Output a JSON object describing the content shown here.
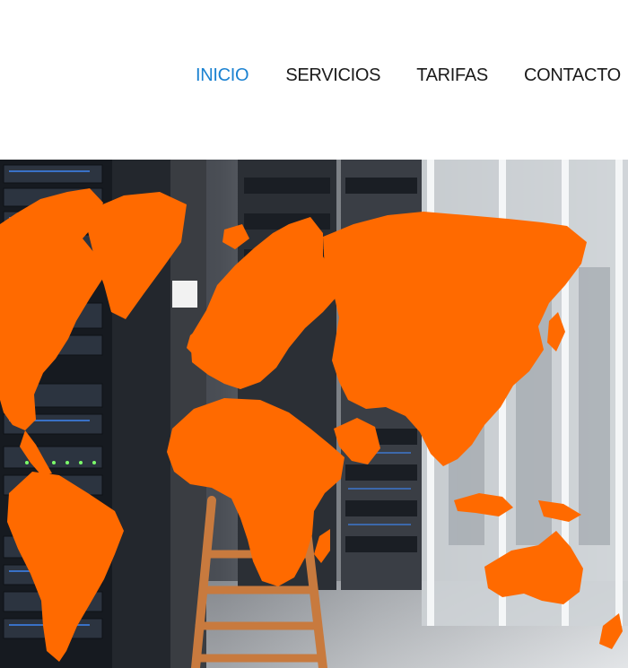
{
  "nav": {
    "items": [
      {
        "label": "INICIO",
        "active": true
      },
      {
        "label": "SERVICIOS",
        "active": false
      },
      {
        "label": "TARIFAS",
        "active": false
      },
      {
        "label": "CONTACTO",
        "active": false
      }
    ]
  },
  "colors": {
    "nav_active": "#1b82d1",
    "nav_text": "#1a1a1a",
    "map_orange": "#ff6a00",
    "rack_dark": "#1c2128",
    "ladder_wood": "#c87a3e"
  },
  "hero": {
    "description_icon": "world-map-over-server-racks"
  }
}
